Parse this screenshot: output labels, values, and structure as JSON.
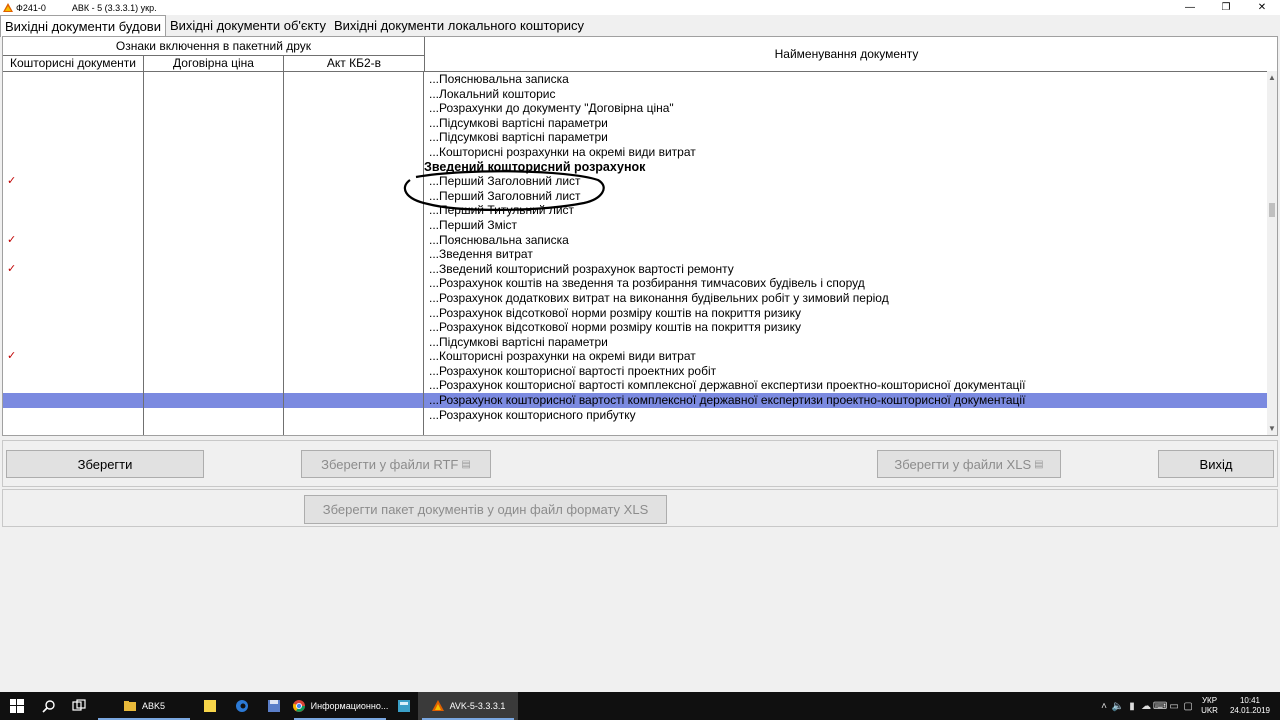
{
  "window": {
    "form_id": "Ф241-0",
    "title": "АВК - 5 (3.3.3.1) укр."
  },
  "tabs": [
    {
      "label": "Вихідні документи будови"
    },
    {
      "label": "Вихідні документи об'єкту"
    },
    {
      "label": "Вихідні документи локального кошторису"
    }
  ],
  "grid": {
    "group_header": "Ознаки включення в пакетний друк",
    "columns": [
      "Кошторисні документи",
      "Договірна ціна",
      "Акт КБ2-в"
    ],
    "name_header": "Найменування документу",
    "check_mark": "✓",
    "rows": [
      {
        "name": "...Пояснювальна записка"
      },
      {
        "name": "...Локальний кошторис"
      },
      {
        "name": "...Розрахунки до документу \"Договірна ціна\""
      },
      {
        "name": "...Підсумкові вартісні параметри"
      },
      {
        "name": "...Підсумкові вартісні параметри"
      },
      {
        "name": "...Кошторисні розрахунки на окремі види витрат"
      },
      {
        "name": "Зведений кошторисний розрахунок",
        "heading": true
      },
      {
        "name": "...Перший Заголовний лист",
        "checked": true
      },
      {
        "name": "...Перший Заголовний лист"
      },
      {
        "name": "...Перший Титульний лист"
      },
      {
        "name": "...Перший Зміст"
      },
      {
        "name": "...Пояснювальна записка",
        "checked": true
      },
      {
        "name": "...Зведення витрат"
      },
      {
        "name": "...Зведений кошторисний розрахунок вартості ремонту",
        "checked": true
      },
      {
        "name": "...Розрахунок коштів на зведення та розбирання тимчасових будівель і споруд"
      },
      {
        "name": "...Розрахунок додаткових витрат на виконання будівельних робіт у зимовий період"
      },
      {
        "name": "...Розрахунок відсоткової норми розміру коштів на покриття ризику"
      },
      {
        "name": "...Розрахунок відсоткової норми розміру коштів на покриття ризику"
      },
      {
        "name": "...Підсумкові вартісні параметри"
      },
      {
        "name": "...Кошторисні розрахунки на окремі види витрат",
        "checked": true
      },
      {
        "name": "...Розрахунок кошторисної вартості проектних робіт"
      },
      {
        "name": "...Розрахунок кошторисної вартості комплексної державної експертизи проектно-кошторисної документації"
      },
      {
        "name": "...Розрахунок кошторисної вартості комплексної державної експертизи проектно-кошторисної документації",
        "selected": true
      },
      {
        "name": "...Розрахунок кошторисного прибутку"
      }
    ]
  },
  "buttons": {
    "save": "Зберегти",
    "save_rtf": "Зберегти у файли RTF",
    "save_xls": "Зберегти у файли  XLS",
    "exit": "Вихід",
    "save_package_xls": "Зберегти пакет документів у один файл формату  XLS"
  },
  "taskbar": {
    "items": [
      {
        "label": "ABK5",
        "icon": "folder-icon"
      },
      {
        "label": "Информационно...",
        "icon": "chrome-icon"
      },
      {
        "label": "AVK-5-3.3.3.1",
        "icon": "avk-app-icon"
      }
    ],
    "lang_top": "УКР",
    "lang_bottom": "UKR",
    "time": "10:41",
    "date": "24.01.2019"
  },
  "colors": {
    "selection": "#7b8ae0",
    "check": "#c00000",
    "annotation": "#000000"
  }
}
